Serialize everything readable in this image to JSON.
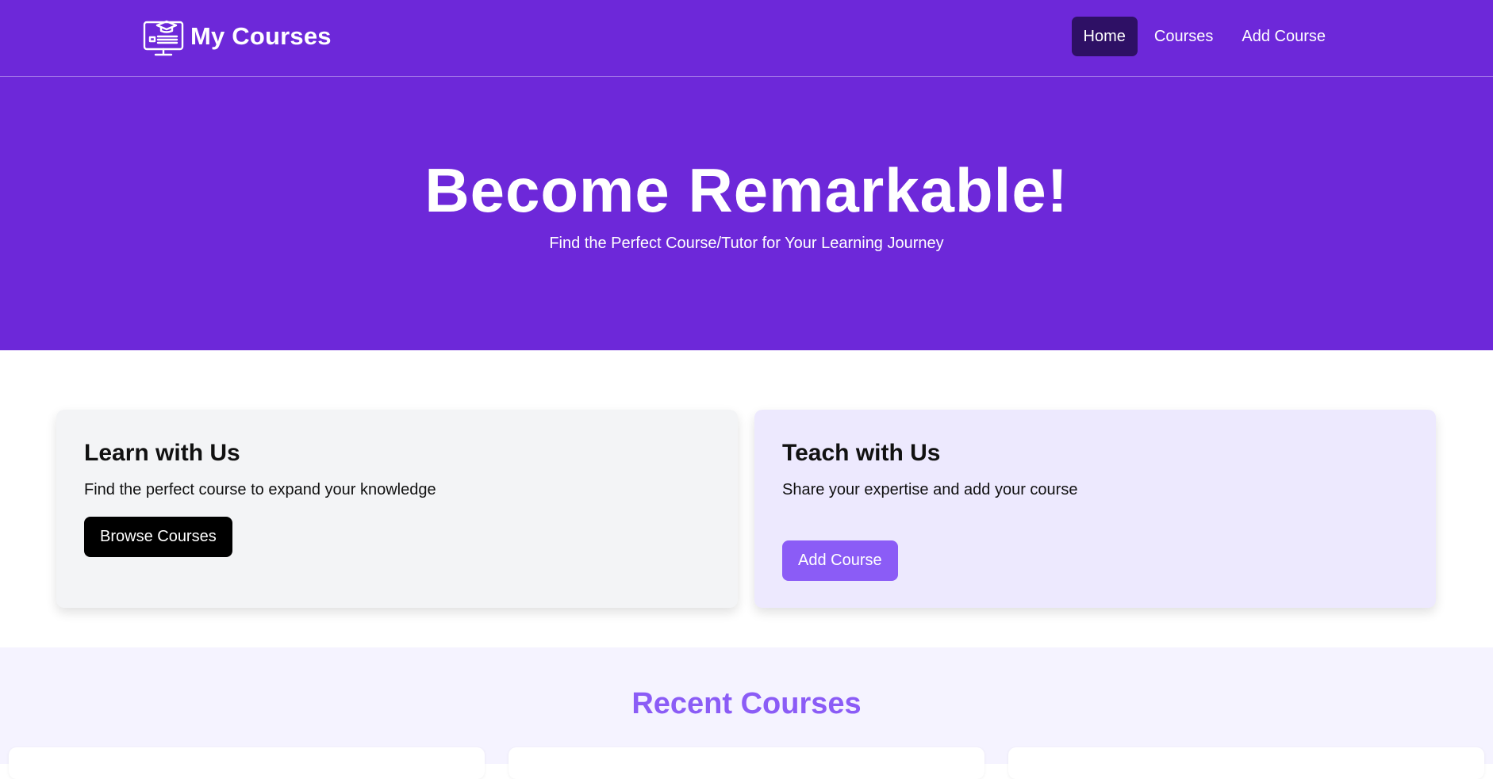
{
  "header": {
    "brand_name": "My Courses",
    "brand_icon": "course-monitor-icon",
    "nav": [
      {
        "label": "Home",
        "active": true
      },
      {
        "label": "Courses",
        "active": false
      },
      {
        "label": "Add Course",
        "active": false
      }
    ]
  },
  "hero": {
    "title": "Become Remarkable!",
    "subtitle": "Find the Perfect Course/Tutor for Your Learning Journey"
  },
  "cards": {
    "learn": {
      "title": "Learn with Us",
      "text": "Find the perfect course to expand your knowledge",
      "button": "Browse Courses"
    },
    "teach": {
      "title": "Teach with Us",
      "text": "Share your expertise and add your course",
      "button": "Add Course"
    }
  },
  "recent": {
    "title": "Recent Courses"
  },
  "colors": {
    "primary": "#6d28d9",
    "nav_active": "#2e1065",
    "accent": "#8b5cf6",
    "card_learn_bg": "#f3f4f6",
    "card_teach_bg": "#ede9fe",
    "recent_bg": "#f5f3ff"
  }
}
